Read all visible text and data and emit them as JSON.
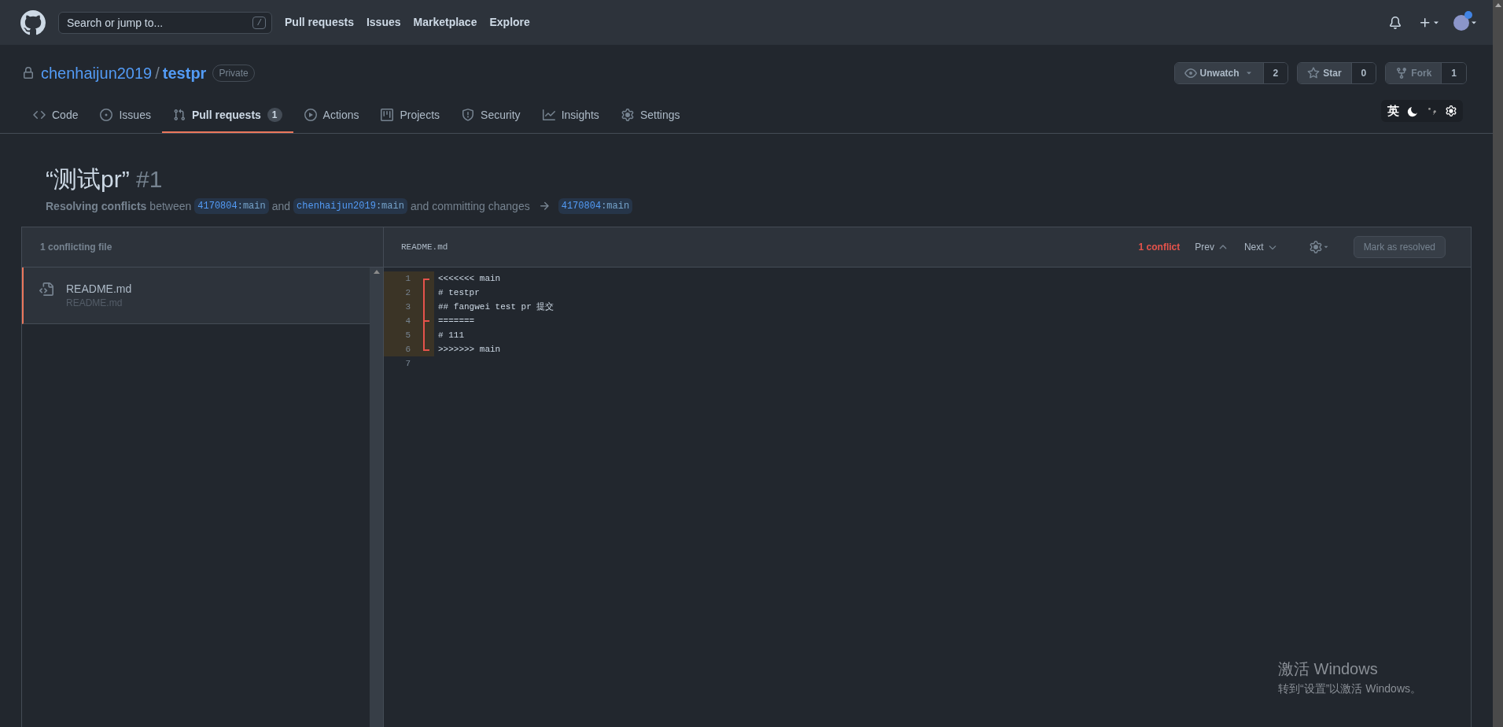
{
  "header": {
    "search": {
      "placeholder": "Search or jump to...",
      "shortcut": "/"
    },
    "nav": [
      "Pull requests",
      "Issues",
      "Marketplace",
      "Explore"
    ]
  },
  "repo": {
    "owner": "chenhaijun2019",
    "separator": "/",
    "name": "testpr",
    "visibility": "Private",
    "actions": [
      {
        "kind": "watch",
        "label": "Unwatch",
        "count": "2",
        "disabled": false
      },
      {
        "kind": "star",
        "label": "Star",
        "count": "0",
        "disabled": false
      },
      {
        "kind": "fork",
        "label": "Fork",
        "count": "1",
        "disabled": true
      }
    ]
  },
  "tabs": [
    {
      "kind": "code",
      "label": "Code",
      "selected": false
    },
    {
      "kind": "issues",
      "label": "Issues",
      "selected": false
    },
    {
      "kind": "pull",
      "label": "Pull requests",
      "counter": "1",
      "selected": true
    },
    {
      "kind": "actions",
      "label": "Actions",
      "selected": false
    },
    {
      "kind": "projects",
      "label": "Projects",
      "selected": false
    },
    {
      "kind": "security",
      "label": "Security",
      "selected": false
    },
    {
      "kind": "insights",
      "label": "Insights",
      "selected": false
    },
    {
      "kind": "settings",
      "label": "Settings",
      "selected": false
    }
  ],
  "input_widget": {
    "language": "英"
  },
  "pull_request": {
    "title": "“测试pr”",
    "number": "#1",
    "summary": [
      {
        "kind": "strong",
        "text": "Resolving conflicts"
      },
      {
        "kind": "text",
        "text": "between"
      },
      {
        "kind": "branch",
        "owner": "4170804",
        "branch": ":main"
      },
      {
        "kind": "text",
        "text": "and"
      },
      {
        "kind": "branch",
        "owner": "chenhaijun2019",
        "branch": ":main"
      },
      {
        "kind": "text",
        "text": "and committing changes"
      },
      {
        "kind": "arrow"
      },
      {
        "kind": "branch",
        "owner": "4170804",
        "branch": ":main"
      }
    ]
  },
  "files_panel": {
    "heading": "1 conflicting file",
    "files": [
      {
        "name": "README.md",
        "path": "README.md",
        "selected": true
      }
    ]
  },
  "editor": {
    "filename": "README.md",
    "conflict_count": "1 conflict",
    "prev": "Prev",
    "next": "Next",
    "resolve_button": {
      "label": "Mark as resolved",
      "disabled": true
    },
    "lines": [
      {
        "number": "1",
        "text": "<<<<<<< main",
        "kind": "start"
      },
      {
        "number": "2",
        "text": "# testpr",
        "kind": "mid"
      },
      {
        "number": "3",
        "text": "## fangwei test pr 提交",
        "kind": "mid"
      },
      {
        "number": "4",
        "text": "=======",
        "kind": "separator"
      },
      {
        "number": "5",
        "text": "# 111",
        "kind": "mid"
      },
      {
        "number": "6",
        "text": ">>>>>>> main",
        "kind": "end"
      },
      {
        "number": "7",
        "kind": "plain"
      }
    ]
  },
  "activation_notice": {
    "title": "激活 Windows",
    "message": "转到“设置”以激活 Windows。"
  }
}
